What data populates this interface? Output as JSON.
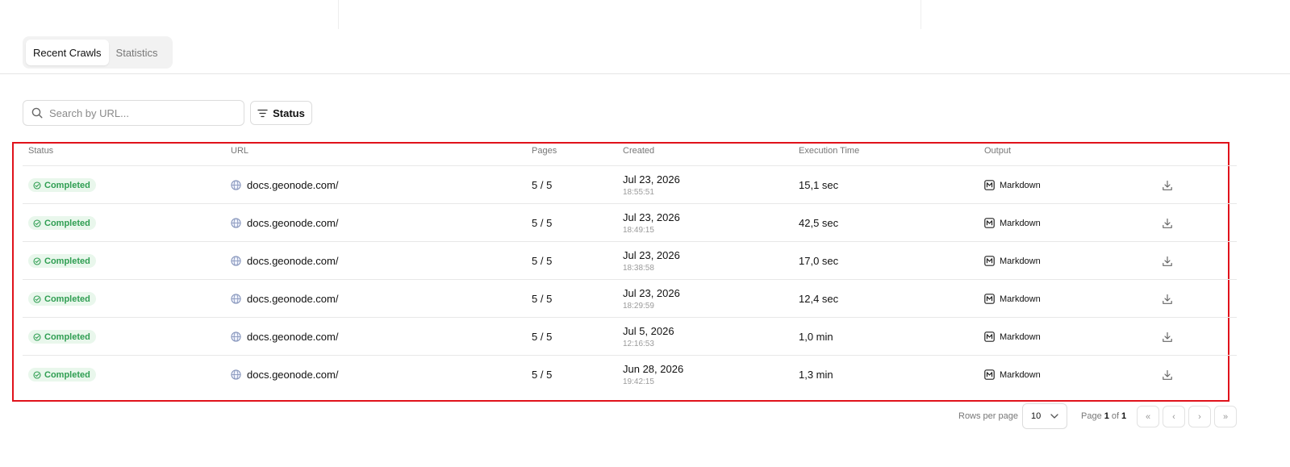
{
  "tabs": [
    {
      "label": "Recent Crawls",
      "active": true
    },
    {
      "label": "Statistics",
      "active": false
    }
  ],
  "search": {
    "placeholder": "Search by URL...",
    "value": ""
  },
  "filter": {
    "label": "Status"
  },
  "table": {
    "columns": [
      "Status",
      "URL",
      "Pages",
      "Created",
      "Execution Time",
      "Output"
    ],
    "rows": [
      {
        "status": "Completed",
        "url": "docs.geonode.com/",
        "pages": "5 / 5",
        "date": "Jul 23, 2026",
        "time": "18:55:51",
        "exec": "15,1 sec",
        "output": "Markdown"
      },
      {
        "status": "Completed",
        "url": "docs.geonode.com/",
        "pages": "5 / 5",
        "date": "Jul 23, 2026",
        "time": "18:49:15",
        "exec": "42,5 sec",
        "output": "Markdown"
      },
      {
        "status": "Completed",
        "url": "docs.geonode.com/",
        "pages": "5 / 5",
        "date": "Jul 23, 2026",
        "time": "18:38:58",
        "exec": "17,0 sec",
        "output": "Markdown"
      },
      {
        "status": "Completed",
        "url": "docs.geonode.com/",
        "pages": "5 / 5",
        "date": "Jul 23, 2026",
        "time": "18:29:59",
        "exec": "12,4 sec",
        "output": "Markdown"
      },
      {
        "status": "Completed",
        "url": "docs.geonode.com/",
        "pages": "5 / 5",
        "date": "Jul 5, 2026",
        "time": "12:16:53",
        "exec": "1,0 min",
        "output": "Markdown"
      },
      {
        "status": "Completed",
        "url": "docs.geonode.com/",
        "pages": "5 / 5",
        "date": "Jun 28, 2026",
        "time": "19:42:15",
        "exec": "1,3 min",
        "output": "Markdown"
      }
    ]
  },
  "pagination": {
    "rows_per_page_label": "Rows per page",
    "rows_per_page_value": "10",
    "page_prefix": "Page",
    "current_page": "1",
    "of_label": "of",
    "total_pages": "1",
    "first": "«",
    "prev": "‹",
    "next": "›",
    "last": "»"
  },
  "colors": {
    "status_completed": "#2f9e52",
    "status_completed_bg": "#e9f7ec",
    "highlight_border": "#e0121b"
  },
  "icons": {
    "search": "search-icon",
    "filter": "filter-icon",
    "status": "check-circle-icon",
    "url": "globe-icon",
    "output": "markdown-icon",
    "action": "download-icon"
  }
}
